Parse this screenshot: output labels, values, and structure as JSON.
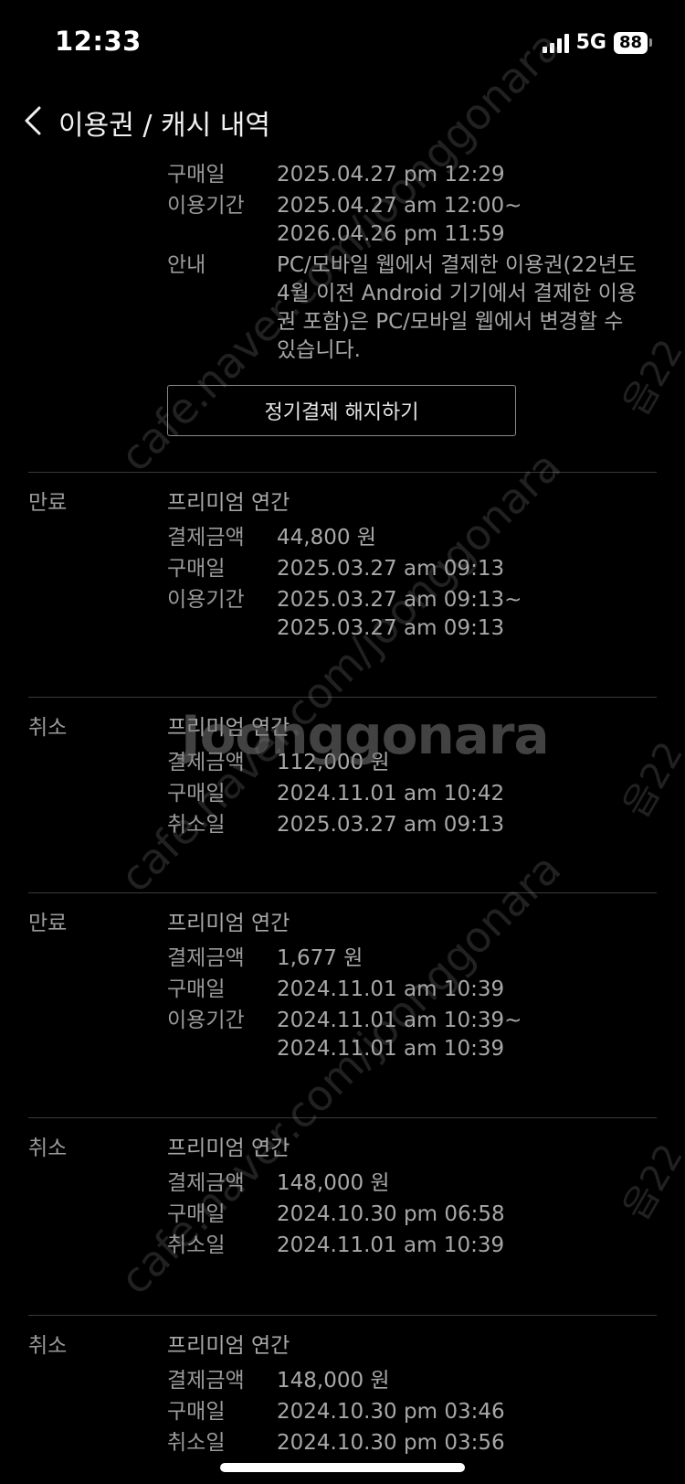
{
  "status_bar": {
    "time": "12:33",
    "network": "5G",
    "battery": "88"
  },
  "nav": {
    "title": "이용권 / 캐시 내역"
  },
  "current": {
    "rows": [
      {
        "label": "구매일",
        "value": "2025.04.27 pm 12:29"
      },
      {
        "label": "이용기간",
        "value": "2025.04.27 am 12:00~\n2026.04.26 pm 11:59"
      },
      {
        "label": "안내",
        "value": "PC/모바일 웹에서 결제한 이용권(22년도 4월 이전 Android 기기에서 결제한 이용권 포함)은 PC/모바일 웹에서 변경할 수 있습니다."
      }
    ],
    "button_label": "정기결제 해지하기"
  },
  "history": [
    {
      "status": "만료",
      "product": "프리미엄 연간",
      "rows": [
        {
          "label": "결제금액",
          "value": "44,800 원"
        },
        {
          "label": "구매일",
          "value": "2025.03.27 am 09:13"
        },
        {
          "label": "이용기간",
          "value": "2025.03.27 am 09:13~\n2025.03.27 am 09:13"
        }
      ]
    },
    {
      "status": "취소",
      "product": "프리미엄 연간",
      "rows": [
        {
          "label": "결제금액",
          "value": "112,000 원"
        },
        {
          "label": "구매일",
          "value": "2024.11.01 am 10:42"
        },
        {
          "label": "취소일",
          "value": "2025.03.27 am 09:13"
        }
      ]
    },
    {
      "status": "만료",
      "product": "프리미엄 연간",
      "rows": [
        {
          "label": "결제금액",
          "value": "1,677 원"
        },
        {
          "label": "구매일",
          "value": "2024.11.01 am 10:39"
        },
        {
          "label": "이용기간",
          "value": "2024.11.01 am 10:39~\n2024.11.01 am 10:39"
        }
      ]
    },
    {
      "status": "취소",
      "product": "프리미엄 연간",
      "rows": [
        {
          "label": "결제금액",
          "value": "148,000 원"
        },
        {
          "label": "구매일",
          "value": "2024.10.30 pm 06:58"
        },
        {
          "label": "취소일",
          "value": "2024.11.01 am 10:39"
        }
      ]
    },
    {
      "status": "취소",
      "product": "프리미엄 연간",
      "rows": [
        {
          "label": "결제금액",
          "value": "148,000 원"
        },
        {
          "label": "구매일",
          "value": "2024.10.30 pm 03:46"
        },
        {
          "label": "취소일",
          "value": "2024.10.30 pm 03:56"
        }
      ]
    }
  ],
  "watermarks": {
    "site": "cafe.naver.com/joonggonara",
    "logo": "Joonggonara",
    "side": "읍22"
  }
}
